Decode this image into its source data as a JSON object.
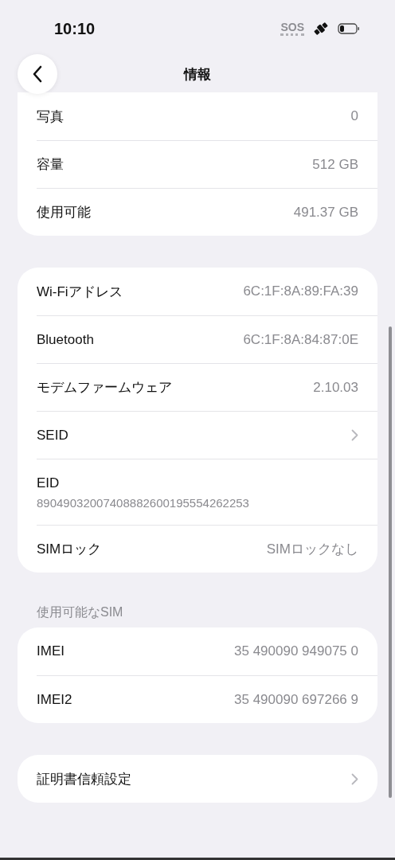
{
  "status_bar": {
    "time": "10:10",
    "sos": "SOS"
  },
  "nav": {
    "title": "情報"
  },
  "groups": [
    {
      "rows": [
        {
          "kind": "value",
          "label": "写真",
          "value": "0"
        },
        {
          "kind": "value",
          "label": "容量",
          "value": "512 GB"
        },
        {
          "kind": "value",
          "label": "使用可能",
          "value": "491.37 GB"
        }
      ]
    },
    {
      "rows": [
        {
          "kind": "value",
          "label": "Wi-Fiアドレス",
          "value": "6C:1F:8A:89:FA:39"
        },
        {
          "kind": "value",
          "label": "Bluetooth",
          "value": "6C:1F:8A:84:87:0E"
        },
        {
          "kind": "value",
          "label": "モデムファームウェア",
          "value": "2.10.03"
        },
        {
          "kind": "chevron",
          "label": "SEID"
        },
        {
          "kind": "stacked",
          "label": "EID",
          "value": "89049032007408882600195554262253"
        },
        {
          "kind": "value",
          "label": "SIMロック",
          "value": "SIMロックなし"
        }
      ]
    },
    {
      "header": "使用可能なSIM",
      "rows": [
        {
          "kind": "value",
          "label": "IMEI",
          "value": "35 490090 949075 0"
        },
        {
          "kind": "value",
          "label": "IMEI2",
          "value": "35 490090 697266 9"
        }
      ]
    },
    {
      "rows": [
        {
          "kind": "chevron",
          "label": "証明書信頼設定"
        }
      ]
    }
  ]
}
